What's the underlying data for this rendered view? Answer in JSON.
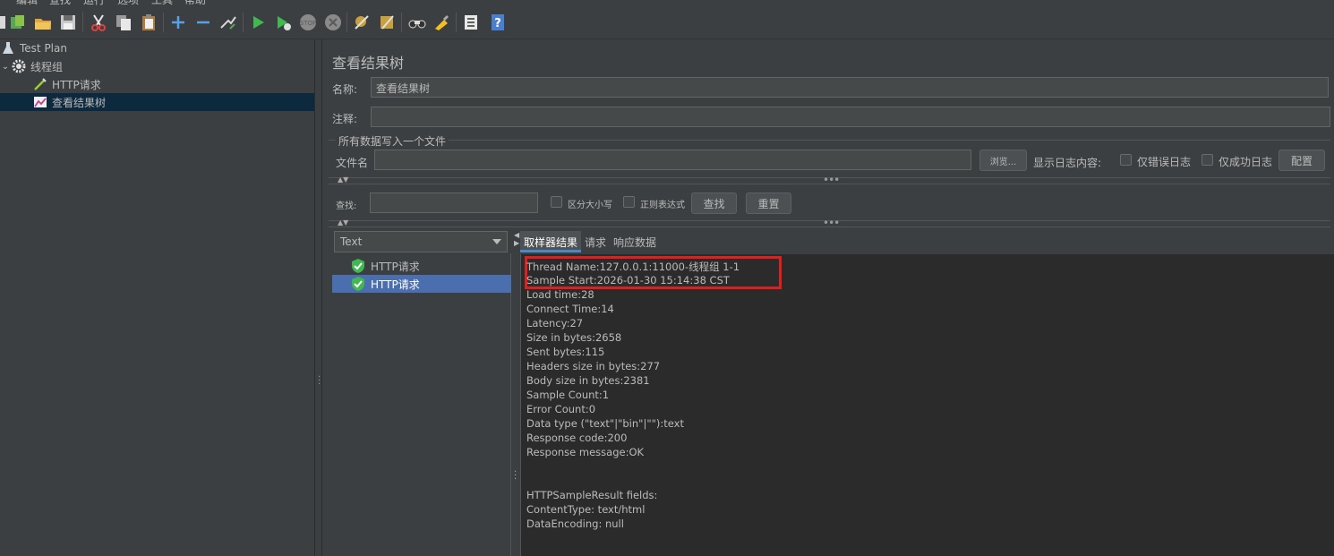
{
  "menubar": {
    "items": [
      "编辑",
      "查找",
      "运行",
      "选项",
      "工具",
      "帮助"
    ]
  },
  "toolbar": {
    "buttons": [
      "templates-icon",
      "open-icon",
      "save-icon",
      "cut-icon",
      "copy-icon",
      "paste-icon",
      "expand-icon",
      "collapse-icon",
      "toggle-icon",
      "start-icon",
      "start-no-pause-icon",
      "stop-icon",
      "shutdown-icon",
      "clear-icon",
      "clear-all-icon",
      "search-icon",
      "reset-search-icon",
      "function-helper-icon",
      "help-icon"
    ]
  },
  "tree": {
    "items": [
      {
        "label": "Test Plan",
        "icon": "test-plan-icon"
      },
      {
        "label": "线程组",
        "icon": "gear-icon"
      },
      {
        "label": "HTTP请求",
        "icon": "sampler-icon"
      },
      {
        "label": "查看结果树",
        "icon": "listener-icon"
      }
    ]
  },
  "panel": {
    "title": "查看结果树",
    "name_label": "名称:",
    "name_value": "查看结果树",
    "comment_label": "注释:",
    "comment_value": "",
    "file_group_label": "所有数据写入一个文件",
    "filename_label": "文件名",
    "filename_value": "",
    "browse_label": "浏览...",
    "log_display_label": "显示日志内容:",
    "errors_only_label": "仅错误日志",
    "success_only_label": "仅成功日志",
    "configure_label": "配置",
    "search_label": "查找:",
    "search_value": "",
    "case_sensitive_label": "区分大小写",
    "regex_label": "正则表达式",
    "find_button": "查找",
    "reset_button": "重置"
  },
  "results": {
    "renderer": "Text",
    "items": [
      "HTTP请求",
      "HTTP请求"
    ],
    "tabs": [
      "取样器结果",
      "请求",
      "响应数据"
    ],
    "lines": [
      "Thread Name:127.0.0.1:11000-线程组 1-1",
      "Sample Start:2026-01-30 15:14:38 CST",
      "Load time:28",
      "Connect Time:14",
      "Latency:27",
      "Size in bytes:2658",
      "Sent bytes:115",
      "Headers size in bytes:277",
      "Body size in bytes:2381",
      "Sample Count:1",
      "Error Count:0",
      "Data type (\"text\"|\"bin\"|\"\"):text",
      "Response code:200",
      "Response message:OK",
      "",
      "",
      "HTTPSampleResult fields:",
      "ContentType: text/html",
      "DataEncoding: null"
    ]
  },
  "colors": {
    "background": "#3c3f41",
    "selection": "#4b6eaf",
    "highlight": "#e01e1e",
    "tree_selection": "#0d293e"
  }
}
